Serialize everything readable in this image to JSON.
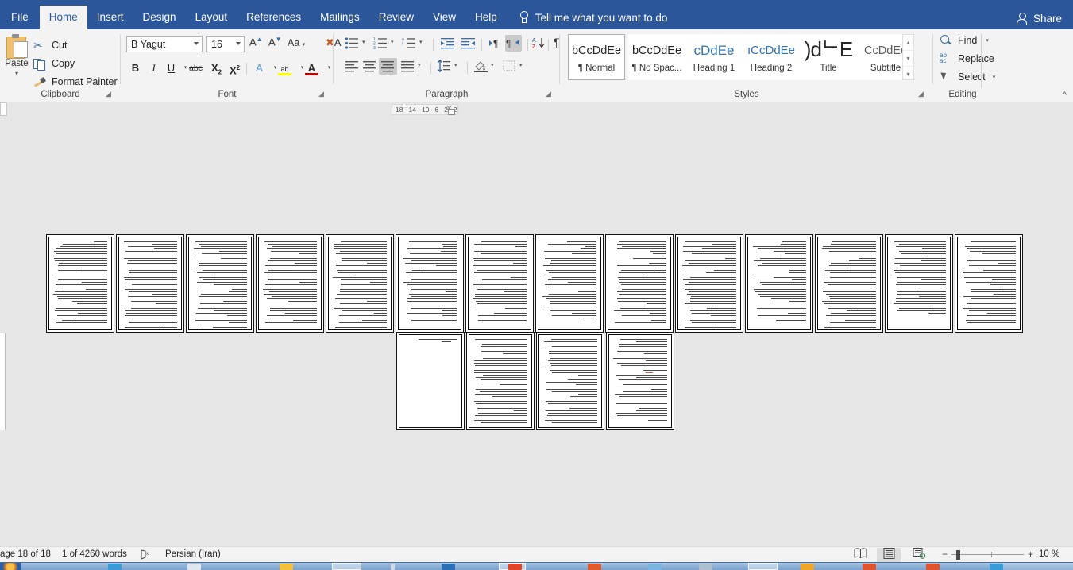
{
  "app": {
    "tabs": [
      {
        "label": "File",
        "active": false,
        "name": "tab-file"
      },
      {
        "label": "Home",
        "active": true,
        "name": "tab-home"
      },
      {
        "label": "Insert",
        "active": false,
        "name": "tab-insert"
      },
      {
        "label": "Design",
        "active": false,
        "name": "tab-design"
      },
      {
        "label": "Layout",
        "active": false,
        "name": "tab-layout"
      },
      {
        "label": "References",
        "active": false,
        "name": "tab-references"
      },
      {
        "label": "Mailings",
        "active": false,
        "name": "tab-mailings"
      },
      {
        "label": "Review",
        "active": false,
        "name": "tab-review"
      },
      {
        "label": "View",
        "active": false,
        "name": "tab-view"
      },
      {
        "label": "Help",
        "active": false,
        "name": "tab-help"
      }
    ],
    "tellme": "Tell me what you want to do",
    "share": "Share",
    "accent": "#2b579a"
  },
  "ribbon": {
    "clipboard": {
      "label": "Clipboard",
      "paste": "Paste",
      "cut": "Cut",
      "copy": "Copy",
      "format_painter": "Format Painter"
    },
    "font": {
      "label": "Font",
      "font_name": "B Yagut",
      "font_size": "16",
      "grow": "A",
      "shrink": "A",
      "change_case": "Aa",
      "clear_formatting": "A",
      "bold": "B",
      "italic": "I",
      "underline": "U",
      "strikethrough": "abc",
      "subscript": "X",
      "subscript_idx": "2",
      "superscript": "X",
      "superscript_idx": "2",
      "text_effects": "A",
      "highlight": "ab",
      "font_color": "A",
      "font_color_swatch": "#c00000",
      "highlight_swatch": "#ffff00"
    },
    "paragraph": {
      "label": "Paragraph",
      "bullets": "bullets",
      "numbering": "numbering",
      "multilevel": "multilevel-list",
      "decrease_indent": "decrease-indent",
      "increase_indent": "increase-indent",
      "ltr": "left-to-right",
      "rtl": "right-to-left",
      "sort": "sort",
      "show_marks": "¶",
      "align_left": "align-left",
      "align_center": "align-center",
      "align_justify": "align-justify",
      "align_right": "align-right",
      "line_spacing": "line-spacing",
      "shading": "shading",
      "borders": "borders",
      "selected_alignment": "align-justify",
      "selected_direction": "right-to-left"
    },
    "styles": {
      "label": "Styles",
      "items": [
        {
          "preview": "bCcDdEe",
          "name": "¶ Normal",
          "selected": true,
          "color": "#262626"
        },
        {
          "preview": "bCcDdEe",
          "name": "¶ No Spac...",
          "selected": false,
          "color": "#262626"
        },
        {
          "preview": "cDdEe",
          "name": "Heading 1",
          "selected": false,
          "color": "#2e74b5"
        },
        {
          "preview": "ıCcDdEe",
          "name": "Heading 2",
          "selected": false,
          "color": "#2e74b5"
        },
        {
          "preview": ")dᄂE",
          "name": "Title",
          "selected": false,
          "color": "#111111"
        },
        {
          "preview": "CcDdEe",
          "name": "Subtitle",
          "selected": false,
          "color": "#5a5a5a"
        }
      ]
    },
    "editing": {
      "label": "Editing",
      "find": "Find",
      "replace": "Replace",
      "select": "Select",
      "collapse_ribbon": "collapse-ribbon"
    }
  },
  "ruler": {
    "visible_ticks": [
      "18",
      "14",
      "10",
      "6",
      "2",
      "2"
    ]
  },
  "document": {
    "zoom_percent": "10 %",
    "page_count": 18,
    "row1_pages": 14,
    "row2_pages": 4,
    "thumbnail_note": "page-thumbnails"
  },
  "status": {
    "pages": "age 18 of 18",
    "words": "1 of 4260 words",
    "proofing": "proofing-errors-icon",
    "language": "Persian (Iran)",
    "view_read": "read-mode",
    "view_print": "print-layout",
    "view_web": "web-layout",
    "zoom_out": "−",
    "zoom_in": "+",
    "zoom_value": "10 %"
  }
}
